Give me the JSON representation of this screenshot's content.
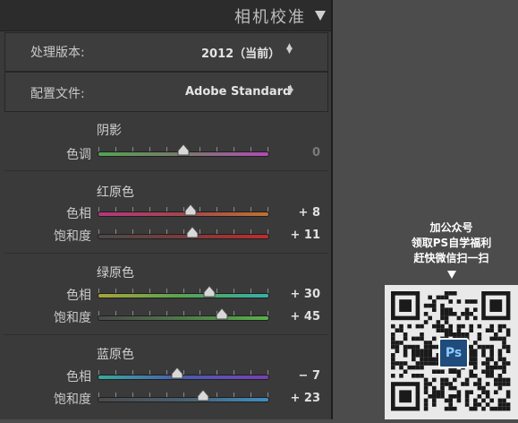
{
  "panel": {
    "title": "相机校准",
    "process": {
      "label": "处理版本:",
      "value": "2012（当前）"
    },
    "profile": {
      "label": "配置文件:",
      "value": "Adobe Standard"
    }
  },
  "groups": [
    {
      "title": "阴影",
      "sliders": [
        {
          "label": "色调",
          "value": "0",
          "level": 0
        }
      ]
    },
    {
      "title": "红原色",
      "sliders": [
        {
          "label": "色相",
          "value": "+ 8",
          "level": 8
        },
        {
          "label": "饱和度",
          "value": "+ 11",
          "level": 11
        }
      ]
    },
    {
      "title": "绿原色",
      "sliders": [
        {
          "label": "色相",
          "value": "+ 30",
          "level": 30
        },
        {
          "label": "饱和度",
          "value": "+ 45",
          "level": 45
        }
      ]
    },
    {
      "title": "蓝原色",
      "sliders": [
        {
          "label": "色相",
          "value": "− 7",
          "level": -7
        },
        {
          "label": "饱和度",
          "value": "+ 23",
          "level": 23
        }
      ]
    }
  ],
  "promo": {
    "lines": [
      "加公众号",
      "领取PS自学福利",
      "赶快微信扫一扫"
    ],
    "badge": "Ps"
  }
}
